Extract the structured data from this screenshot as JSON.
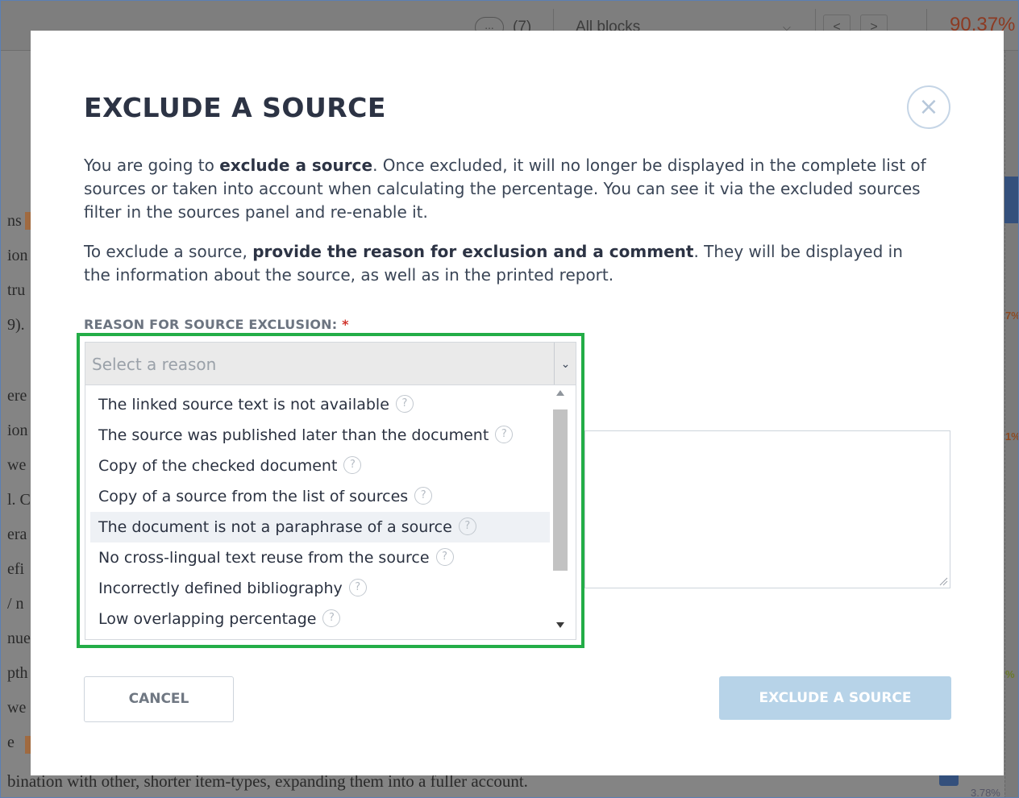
{
  "background": {
    "toolbar": {
      "more_label": "...",
      "count": "(7)",
      "blocks_select": "All blocks",
      "prev_label": "<",
      "next_label": ">",
      "originality_percent": "90.37%"
    },
    "text_fragments": [
      "ns",
      "ion",
      "tru",
      "9).",
      "ere",
      "ion",
      "we",
      "l. C",
      "era",
      "efi",
      "/ n",
      "nue",
      "pth",
      "we",
      "e"
    ],
    "bottom_text": "bination with other, shorter item-types, expanding them into a fuller account.",
    "right_marks": [
      "7%",
      "1%",
      "%"
    ],
    "bottom_percent": "3.78%"
  },
  "modal": {
    "title": "EXCLUDE A SOURCE",
    "close_glyph": "×",
    "paragraph1": {
      "t1": "You are going to ",
      "b1": "exclude a source",
      "t2": ". Once excluded, it will no longer be displayed in the complete list of sources or taken into account when calculating the percentage. You can see it via the excluded sources filter in the sources panel and re-enable it."
    },
    "paragraph2": {
      "t1": "To exclude a source, ",
      "b1": "provide the reason for exclusion and a comment",
      "t2": ". They will be displayed in the information about the source, as well as in the printed report."
    },
    "reason_label": "REASON FOR SOURCE EXCLUSION:",
    "required_mark": "*",
    "select_placeholder": "Select a reason",
    "reasons": [
      "The linked source text is not available",
      "The source was published later than the document",
      "Copy of the checked document",
      "Copy of a source from the list of sources",
      "The document is not a paraphrase of a source",
      "No cross-lingual text reuse from the source",
      "Incorrectly defined bibliography",
      "Low overlapping percentage"
    ],
    "hovered_reason_index": 4,
    "help_glyph": "?",
    "cancel_label": "CANCEL",
    "exclude_label": "EXCLUDE A SOURCE"
  },
  "colors": {
    "highlight_border": "#23ad47",
    "exclude_button": "#b7d3e8",
    "required": "#d0342c",
    "title": "#2c3344"
  }
}
